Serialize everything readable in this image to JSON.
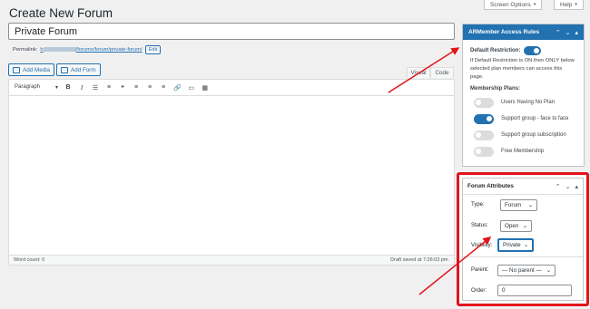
{
  "page": {
    "title": "Create New Forum"
  },
  "screen_options": {
    "label": "Screen Options",
    "caret": "▾"
  },
  "help": {
    "label": "Help",
    "caret": "▾"
  },
  "post_title": "Private Forum",
  "permalink": {
    "label": "Permalink:",
    "url_prefix": "h",
    "url_suffix": "/forums/forum/private-forum/",
    "edit_label": "Edit"
  },
  "media_buttons": {
    "add_media": "Add Media",
    "add_form": "Add Form"
  },
  "editor_tabs": {
    "visual": "Visual",
    "code": "Code"
  },
  "toolbar": {
    "format_select": "Paragraph",
    "format_caret": "▾",
    "bold": "B",
    "italic": "I",
    "ul": "☰",
    "ol": "≡",
    "quote": "❝",
    "align_left": "≡",
    "align_center": "≡",
    "align_right": "≡",
    "link": "🔗",
    "more": "▭",
    "kitchen": "▦"
  },
  "status_bar": {
    "word_count": "Word count: 0",
    "draft_saved": "Draft saved at 7:26:03 pm."
  },
  "access_rules": {
    "title": "ARMember Access Rules",
    "ctrl_up": "⌃",
    "ctrl_down": "⌄",
    "ctrl_toggle": "▴",
    "default_restriction_label": "Default Restriction:",
    "default_restriction_on": true,
    "help": "If Default Restriction is ON then ONLY below selected plan members can access this page.",
    "plans_label": "Membership Plans:",
    "plans": [
      {
        "name": "Users Having No Plan",
        "on": false
      },
      {
        "name": "Support group - face to face",
        "on": true
      },
      {
        "name": "Support group subscription",
        "on": false
      },
      {
        "name": "Free Membership",
        "on": false
      }
    ]
  },
  "forum_attributes": {
    "title": "Forum Attributes",
    "ctrl_up": "⌃",
    "ctrl_down": "⌄",
    "ctrl_toggle": "▴",
    "type_label": "Type:",
    "type_value": "Forum",
    "status_label": "Status:",
    "status_value": "Open",
    "visibility_label": "Visibility:",
    "visibility_value": "Private",
    "parent_label": "Parent:",
    "parent_value": "— No parent —",
    "order_label": "Order:",
    "order_value": "0",
    "caret": "⌄"
  },
  "colors": {
    "accent": "#2271b1",
    "highlight": "#e2141a",
    "arrow": "#e2141a"
  }
}
